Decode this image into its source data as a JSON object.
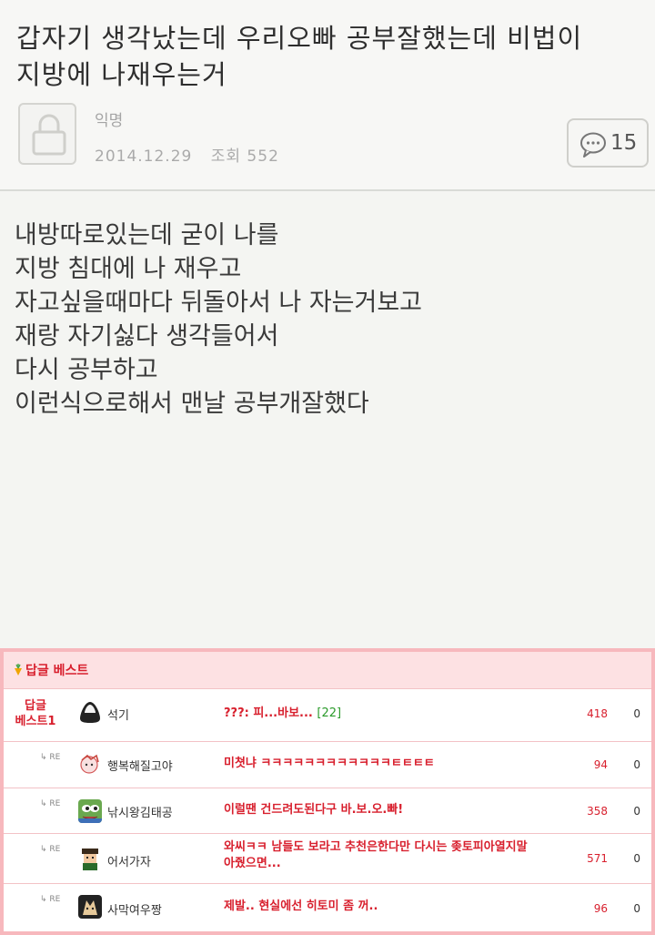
{
  "post": {
    "title_line1": "갑자기 생각났는데 우리오빠 공부잘했는데 비법이",
    "title_line2": "지방에 나재우는거",
    "author": "익명",
    "date": "2014.12.29",
    "views_label": "조회 552",
    "comment_count": "15",
    "body_lines": [
      "내방따로있는데 굳이 나를",
      "지방 침대에 나 재우고",
      "자고싶을때마다 뒤돌아서 나 자는거보고",
      "재랑 자기싫다 생각들어서",
      "다시 공부하고",
      "이런식으로해서 맨날 공부개잘했다"
    ]
  },
  "best_replies": {
    "header_title": "답글 베스트",
    "top": {
      "label_line1": "답글",
      "label_line2": "베스트1",
      "nickname": "석기",
      "text": "???: 피...바보...",
      "reply_count": "[22]",
      "likes": "418",
      "dislikes": "0"
    },
    "re_label": "RE",
    "replies": [
      {
        "nickname": "행복해질고야",
        "text": "미쳣냐 ㅋㅋㅋㅋㅋㅋㅋㅋㅋㅋㅋㅋㅌㅌㅌㅌ",
        "likes": "94",
        "dislikes": "0"
      },
      {
        "nickname": "낚시왕김태공",
        "text": "이럴땐 건드려도된다구 바.보.오.빠!",
        "likes": "358",
        "dislikes": "0"
      },
      {
        "nickname": "어서가자",
        "text_line1": "와씨ㅋㅋ 남들도 보라고 추천은한다만 다시는 좆토피아열지말",
        "text_line2": "아줬으면...",
        "likes": "571",
        "dislikes": "0"
      },
      {
        "nickname": "사막여우짱",
        "text": "제발.. 현실에선 히토미 좀 꺼..",
        "likes": "96",
        "dislikes": "0"
      }
    ]
  },
  "colors": {
    "accent_red": "#d8202e",
    "border_pink": "#f7b8bd",
    "count_green": "#2a9a2a"
  },
  "icons": [
    "lock-icon",
    "speech-bubble-icon",
    "carrot-icon",
    "reply-arrow-icon"
  ]
}
